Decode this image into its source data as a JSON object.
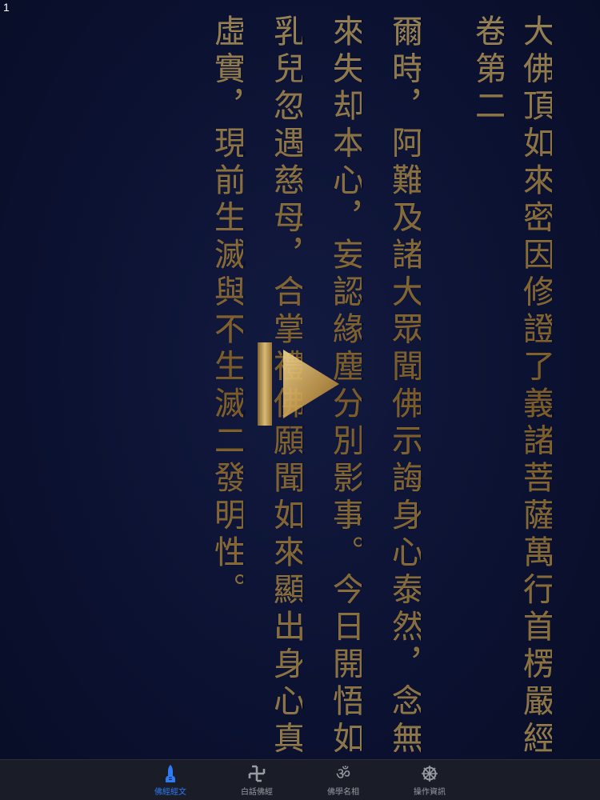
{
  "page_number": "1",
  "scripture": {
    "title_lines": [
      "大佛頂如來密因修證了義諸菩薩萬行首楞嚴經",
      "卷第二"
    ],
    "body_lines": [
      "爾時，阿難及諸大眾聞佛示誨身心泰然，念無始",
      "來失却本心，妄認緣塵分別影事。今日開悟如失",
      "乳兒忽遇慈母，合掌禮佛願聞如來顯出身心真妄",
      "虛實，現前生滅與不生滅二發明性。"
    ]
  },
  "play_button": {
    "icon": "play-icon",
    "color": "#c9a35a"
  },
  "tabbar": {
    "tabs": [
      {
        "label": "佛經經文",
        "icon": "praying-hand-icon",
        "active": true
      },
      {
        "label": "白話佛經",
        "icon": "swastika-icon",
        "active": false
      },
      {
        "label": "佛學名相",
        "icon": "om-icon",
        "active": false
      },
      {
        "label": "操作資訊",
        "icon": "dharma-wheel-icon",
        "active": false
      }
    ],
    "active_color": "#2f7bf5",
    "inactive_color": "#9a9ca4"
  }
}
